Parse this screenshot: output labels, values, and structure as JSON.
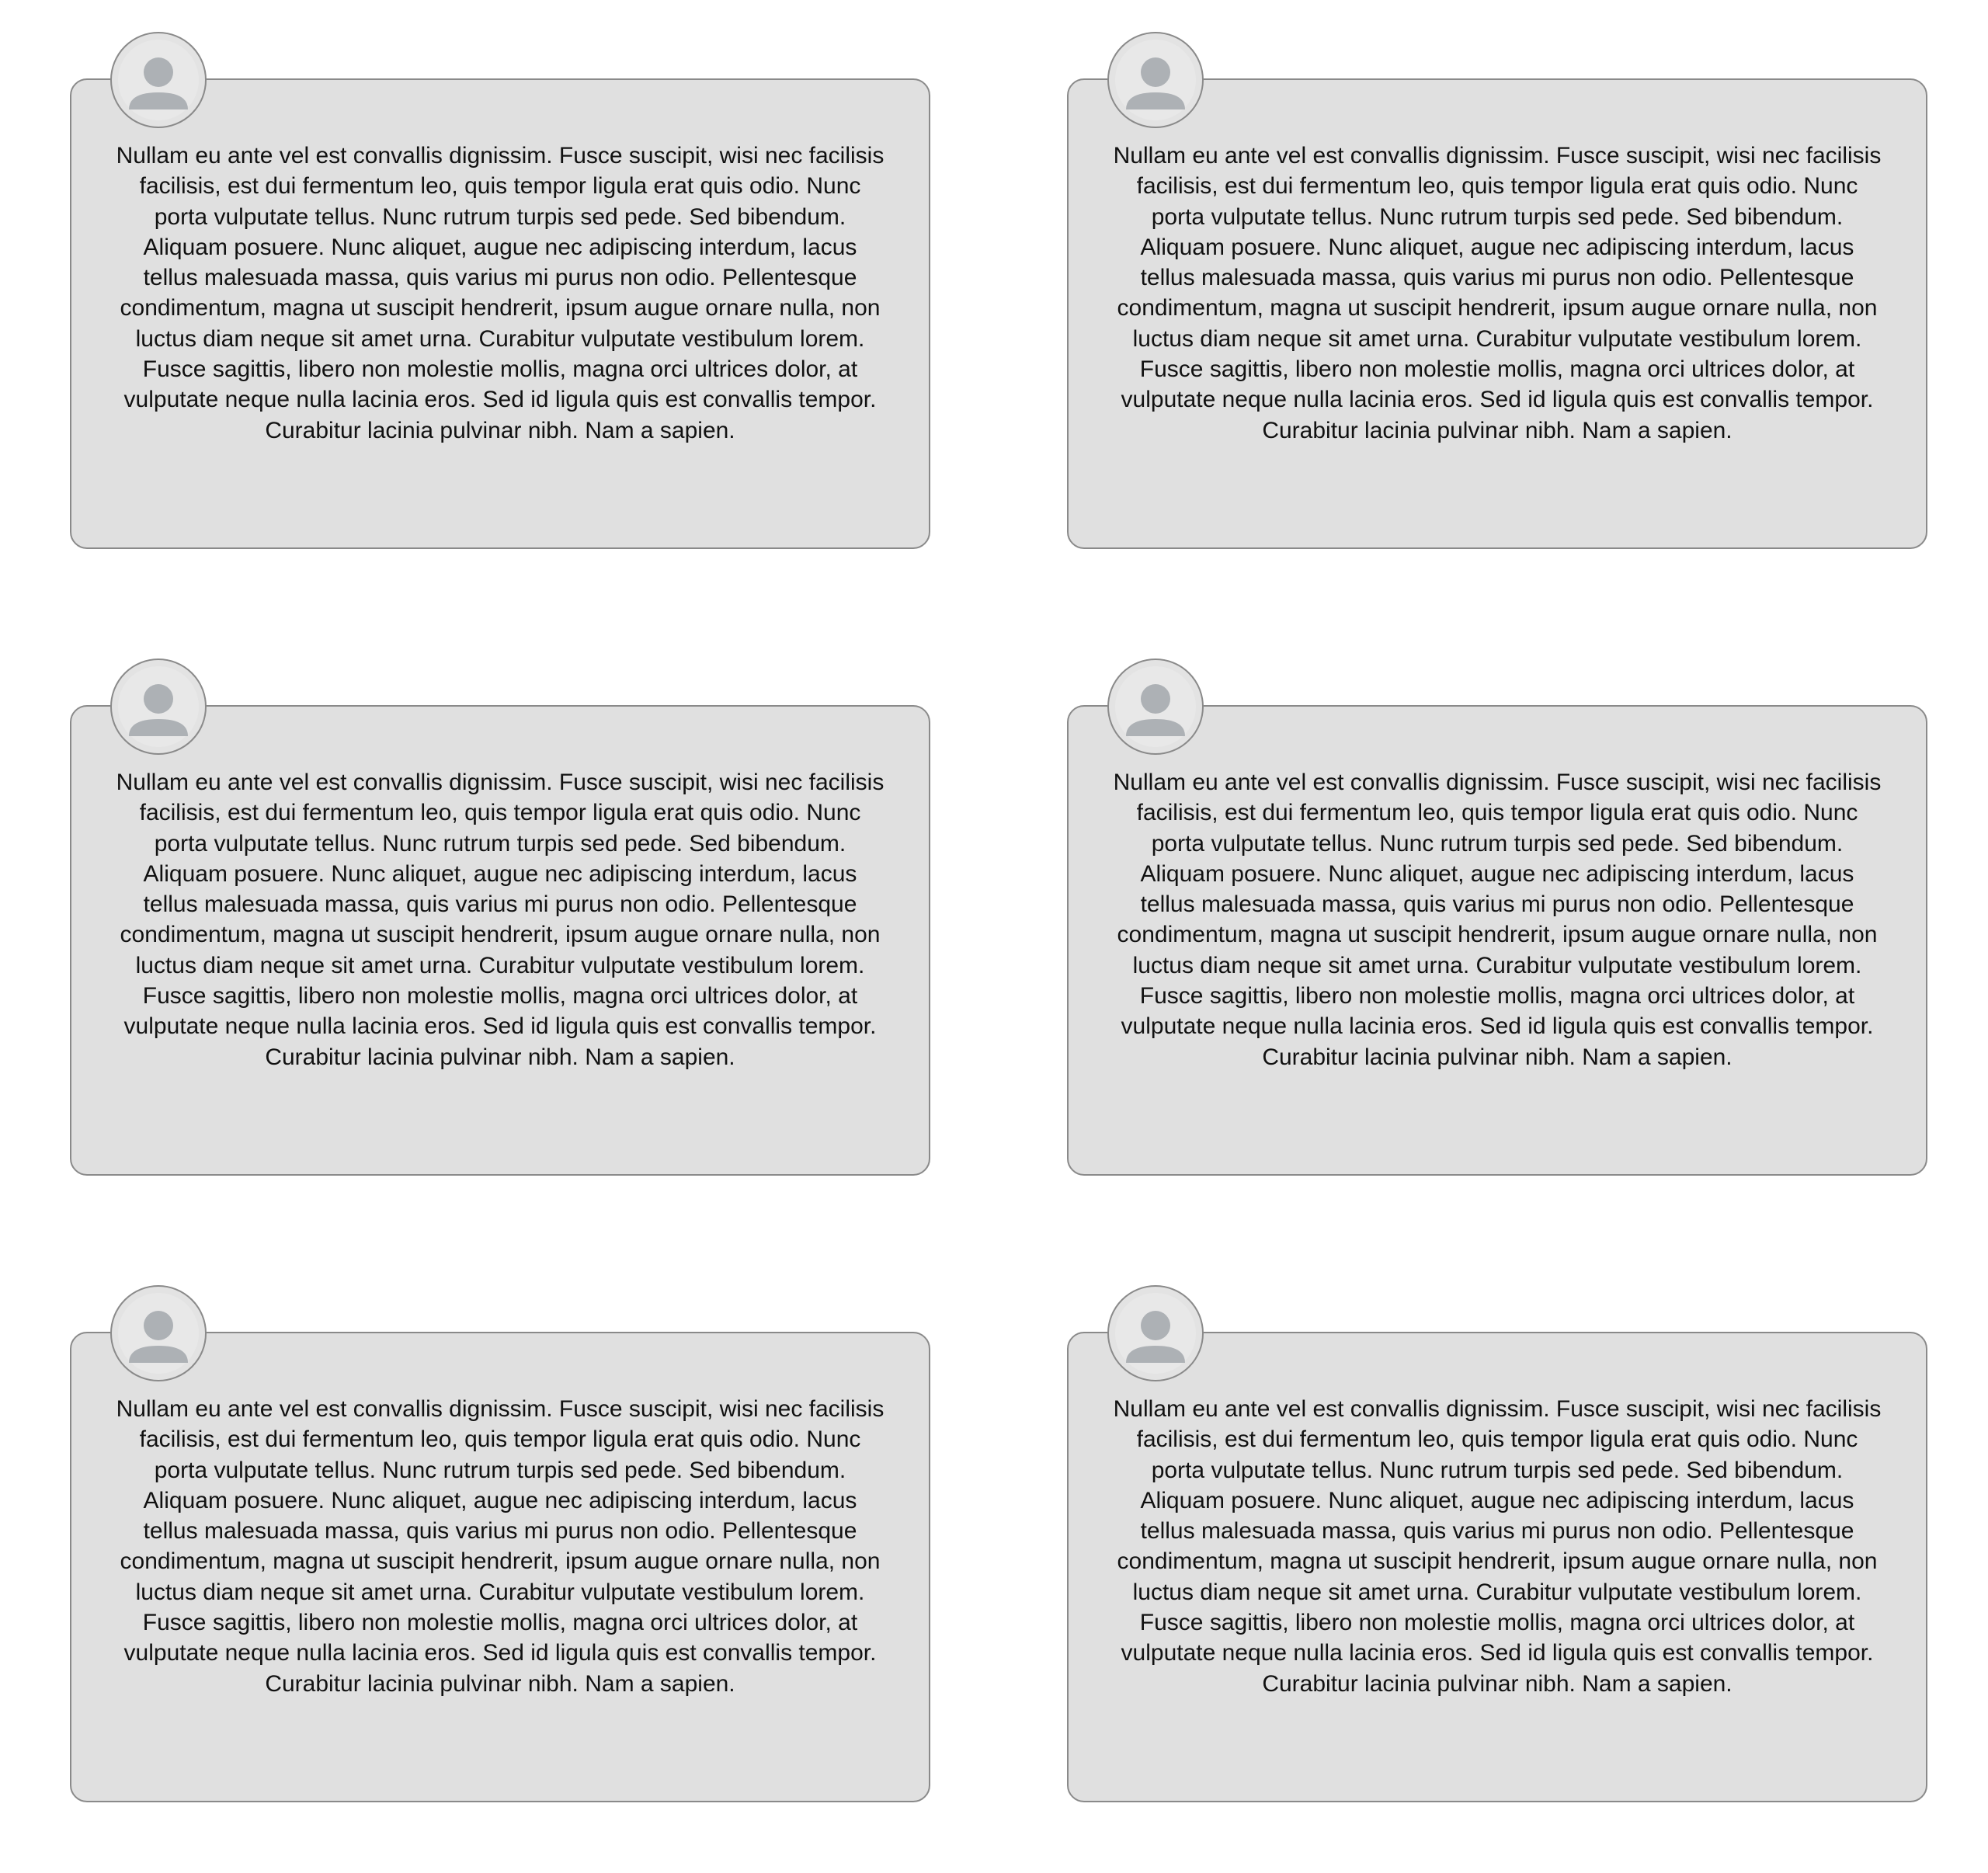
{
  "cards": [
    {
      "avatar_icon": "user-avatar-icon",
      "text": "Nullam eu ante vel est convallis dignissim. Fusce suscipit, wisi nec facilisis facilisis, est dui fermentum leo, quis tempor ligula erat quis odio. Nunc porta vulputate tellus. Nunc rutrum turpis sed pede. Sed bibendum. Aliquam posuere. Nunc aliquet, augue nec adipiscing interdum, lacus tellus malesuada massa, quis varius mi purus non odio. Pellentesque condimentum, magna ut suscipit hendrerit, ipsum augue ornare nulla, non luctus diam neque sit amet urna. Curabitur vulputate vestibulum lorem. Fusce sagittis, libero non molestie mollis, magna orci ultrices dolor, at vulputate neque nulla lacinia eros. Sed id ligula quis est convallis tempor. Curabitur lacinia pulvinar nibh. Nam a sapien."
    },
    {
      "avatar_icon": "user-avatar-icon",
      "text": "Nullam eu ante vel est convallis dignissim. Fusce suscipit, wisi nec facilisis facilisis, est dui fermentum leo, quis tempor ligula erat quis odio. Nunc porta vulputate tellus. Nunc rutrum turpis sed pede. Sed bibendum. Aliquam posuere. Nunc aliquet, augue nec adipiscing interdum, lacus tellus malesuada massa, quis varius mi purus non odio. Pellentesque condimentum, magna ut suscipit hendrerit, ipsum augue ornare nulla, non luctus diam neque sit amet urna. Curabitur vulputate vestibulum lorem. Fusce sagittis, libero non molestie mollis, magna orci ultrices dolor, at vulputate neque nulla lacinia eros. Sed id ligula quis est convallis tempor. Curabitur lacinia pulvinar nibh. Nam a sapien."
    },
    {
      "avatar_icon": "user-avatar-icon",
      "text": "Nullam eu ante vel est convallis dignissim. Fusce suscipit, wisi nec facilisis facilisis, est dui fermentum leo, quis tempor ligula erat quis odio. Nunc porta vulputate tellus. Nunc rutrum turpis sed pede. Sed bibendum. Aliquam posuere. Nunc aliquet, augue nec adipiscing interdum, lacus tellus malesuada massa, quis varius mi purus non odio. Pellentesque condimentum, magna ut suscipit hendrerit, ipsum augue ornare nulla, non luctus diam neque sit amet urna. Curabitur vulputate vestibulum lorem. Fusce sagittis, libero non molestie mollis, magna orci ultrices dolor, at vulputate neque nulla lacinia eros. Sed id ligula quis est convallis tempor. Curabitur lacinia pulvinar nibh. Nam a sapien."
    },
    {
      "avatar_icon": "user-avatar-icon",
      "text": "Nullam eu ante vel est convallis dignissim. Fusce suscipit, wisi nec facilisis facilisis, est dui fermentum leo, quis tempor ligula erat quis odio. Nunc porta vulputate tellus. Nunc rutrum turpis sed pede. Sed bibendum. Aliquam posuere. Nunc aliquet, augue nec adipiscing interdum, lacus tellus malesuada massa, quis varius mi purus non odio. Pellentesque condimentum, magna ut suscipit hendrerit, ipsum augue ornare nulla, non luctus diam neque sit amet urna. Curabitur vulputate vestibulum lorem. Fusce sagittis, libero non molestie mollis, magna orci ultrices dolor, at vulputate neque nulla lacinia eros. Sed id ligula quis est convallis tempor. Curabitur lacinia pulvinar nibh. Nam a sapien."
    },
    {
      "avatar_icon": "user-avatar-icon",
      "text": "Nullam eu ante vel est convallis dignissim. Fusce suscipit, wisi nec facilisis facilisis, est dui fermentum leo, quis tempor ligula erat quis odio. Nunc porta vulputate tellus. Nunc rutrum turpis sed pede. Sed bibendum. Aliquam posuere. Nunc aliquet, augue nec adipiscing interdum, lacus tellus malesuada massa, quis varius mi purus non odio. Pellentesque condimentum, magna ut suscipit hendrerit, ipsum augue ornare nulla, non luctus diam neque sit amet urna. Curabitur vulputate vestibulum lorem. Fusce sagittis, libero non molestie mollis, magna orci ultrices dolor, at vulputate neque nulla lacinia eros. Sed id ligula quis est convallis tempor. Curabitur lacinia pulvinar nibh. Nam a sapien."
    },
    {
      "avatar_icon": "user-avatar-icon",
      "text": "Nullam eu ante vel est convallis dignissim. Fusce suscipit, wisi nec facilisis facilisis, est dui fermentum leo, quis tempor ligula erat quis odio. Nunc porta vulputate tellus. Nunc rutrum turpis sed pede. Sed bibendum. Aliquam posuere. Nunc aliquet, augue nec adipiscing interdum, lacus tellus malesuada massa, quis varius mi purus non odio. Pellentesque condimentum, magna ut suscipit hendrerit, ipsum augue ornare nulla, non luctus diam neque sit amet urna. Curabitur vulputate vestibulum lorem. Fusce sagittis, libero non molestie mollis, magna orci ultrices dolor, at vulputate neque nulla lacinia eros. Sed id ligula quis est convallis tempor. Curabitur lacinia pulvinar nibh. Nam a sapien."
    }
  ],
  "colors": {
    "card_background": "#e0e0e0",
    "card_border": "#8a8a8a",
    "avatar_figure": "#adb1b5",
    "text": "#111111"
  }
}
